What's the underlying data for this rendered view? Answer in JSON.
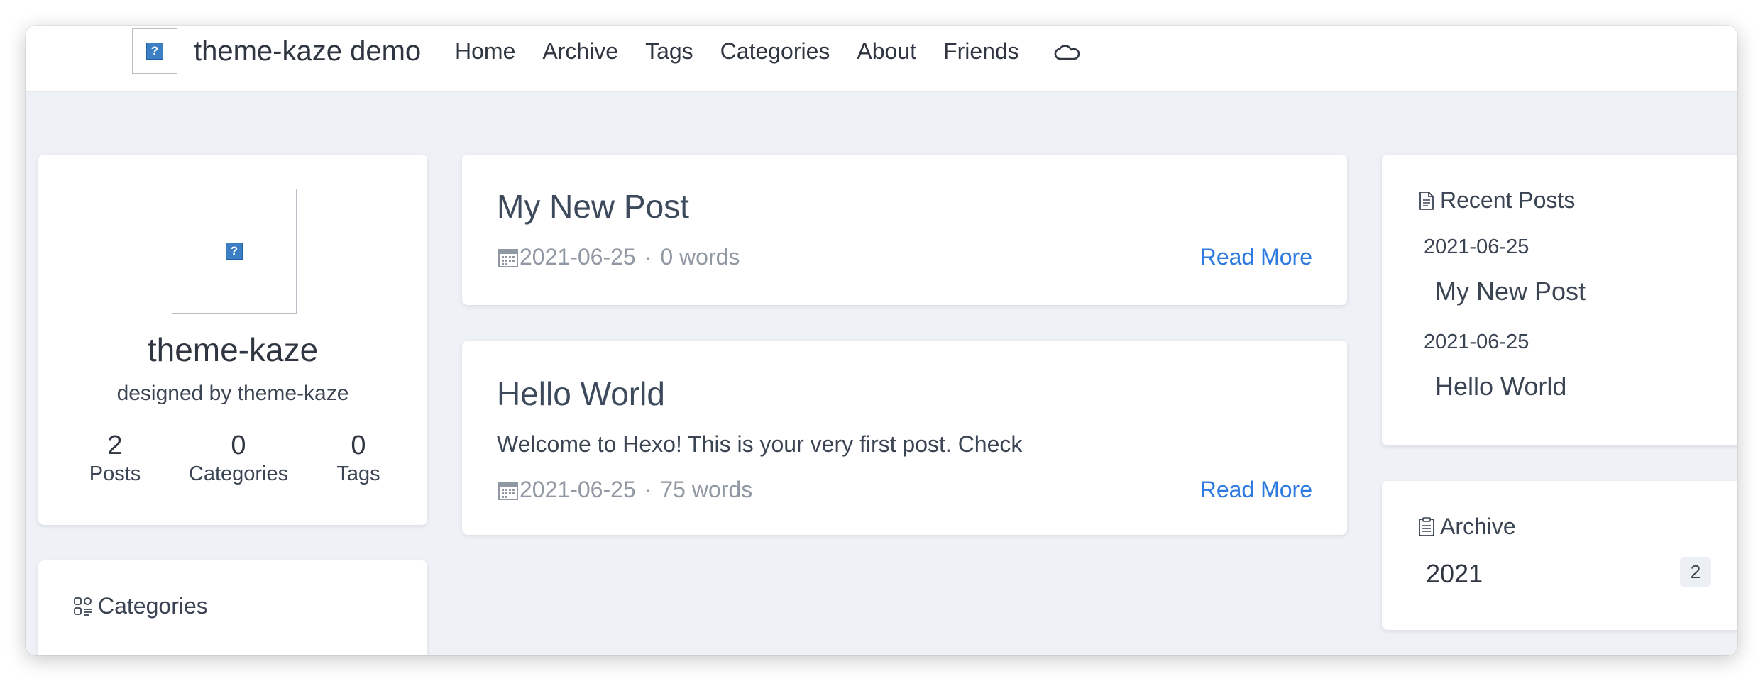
{
  "site": {
    "title": "theme-kaze demo"
  },
  "nav": {
    "items": [
      "Home",
      "Archive",
      "Tags",
      "Categories",
      "About",
      "Friends"
    ]
  },
  "profile": {
    "name": "theme-kaze",
    "description": "designed by theme-kaze",
    "stats": [
      {
        "value": "2",
        "label": "Posts"
      },
      {
        "value": "0",
        "label": "Categories"
      },
      {
        "value": "0",
        "label": "Tags"
      }
    ]
  },
  "categories_widget": {
    "title": "Categories"
  },
  "posts": [
    {
      "title": "My New Post",
      "excerpt": "",
      "date": "2021-06-25",
      "words": "0 words",
      "read_more": "Read More"
    },
    {
      "title": "Hello World",
      "excerpt": "Welcome to Hexo! This is your very first post. Check",
      "date": "2021-06-25",
      "words": "75 words",
      "read_more": "Read More"
    }
  ],
  "recent_posts": {
    "title": "Recent Posts",
    "items": [
      {
        "date": "2021-06-25",
        "title": "My New Post"
      },
      {
        "date": "2021-06-25",
        "title": "Hello World"
      }
    ]
  },
  "archive_widget": {
    "title": "Archive",
    "items": [
      {
        "year": "2021",
        "count": "2"
      }
    ]
  },
  "meta_separator": "·",
  "colors": {
    "background": "#eef1f6",
    "card": "#ffffff",
    "link": "#2d7ae0",
    "meta": "#9098a3"
  }
}
